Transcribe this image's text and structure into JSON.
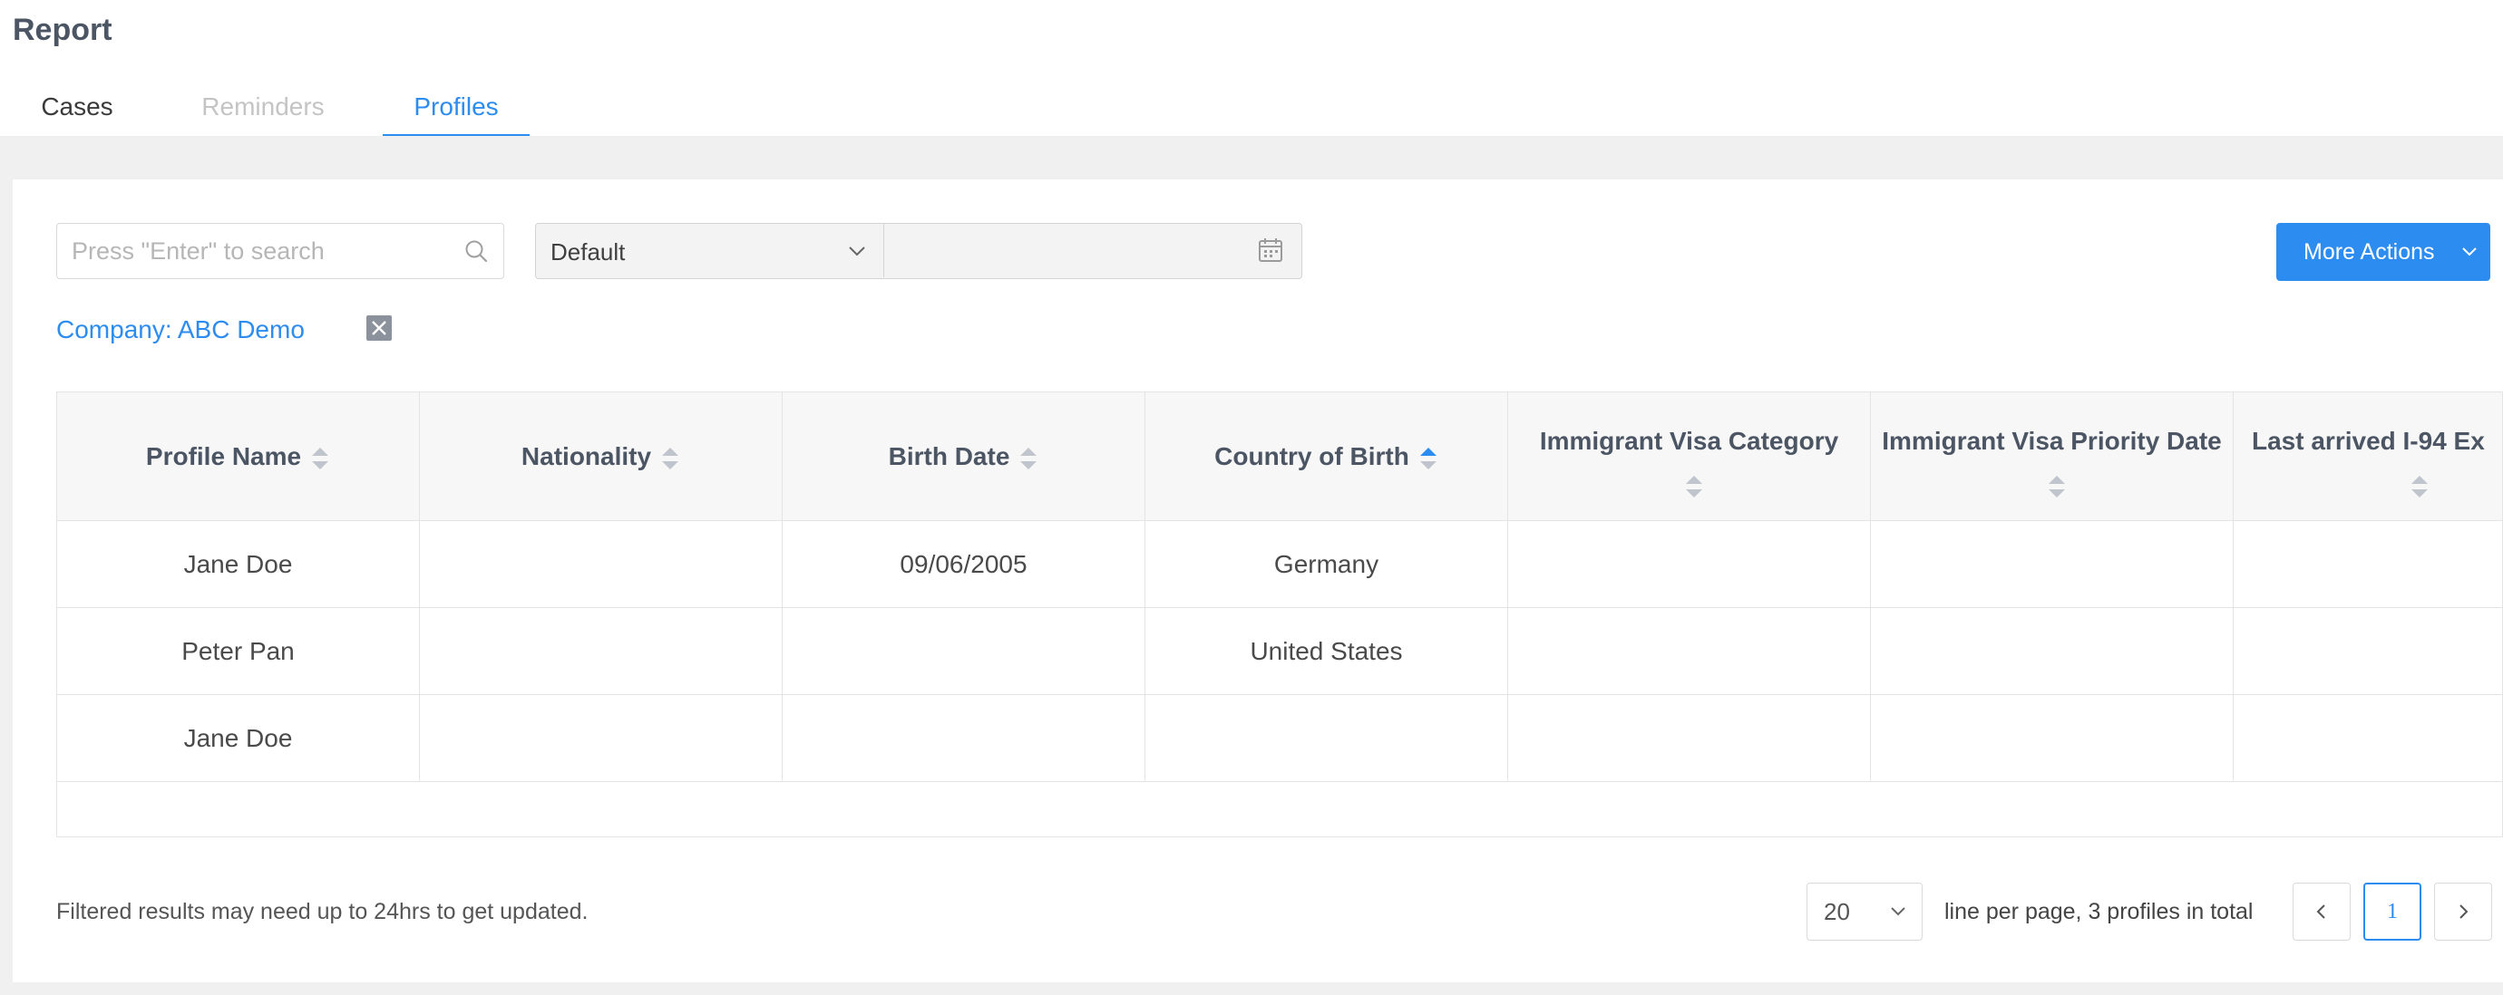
{
  "page": {
    "title": "Report"
  },
  "tabs": {
    "cases": "Cases",
    "reminders": "Reminders",
    "profiles": "Profiles",
    "active": "Profiles"
  },
  "toolbar": {
    "search": {
      "placeholder": "Press \"Enter\" to search",
      "value": ""
    },
    "date_range_type": "Default",
    "date_picker_value": "",
    "more_actions": "More Actions"
  },
  "filters": [
    {
      "label": "Company: ABC Demo"
    }
  ],
  "table": {
    "columns": [
      {
        "label": "Profile Name",
        "sort": "none"
      },
      {
        "label": "Nationality",
        "sort": "none"
      },
      {
        "label": "Birth Date",
        "sort": "none"
      },
      {
        "label": "Country of Birth",
        "sort": "asc"
      },
      {
        "label": "Immigrant Visa Category",
        "sort": "none"
      },
      {
        "label": "Immigrant Visa Priority Date",
        "sort": "none"
      },
      {
        "label": "Last arrived I-94 Ex",
        "sort": "none"
      }
    ],
    "rows": [
      [
        "Jane Doe",
        "",
        "09/06/2005",
        "Germany",
        "",
        "",
        ""
      ],
      [
        "Peter Pan",
        "",
        "",
        "United States",
        "",
        "",
        ""
      ],
      [
        "Jane Doe",
        "",
        "",
        "",
        "",
        "",
        ""
      ]
    ]
  },
  "footer": {
    "note": "Filtered results may need up to 24hrs to get updated.",
    "page_size": "20",
    "summary": "line per page, 3 profiles in total",
    "current_page": "1"
  },
  "colors": {
    "accent": "#2d8cf0",
    "sort_inactive": "#c0c4cc"
  },
  "icons": {
    "search": "search-icon",
    "calendar": "calendar-icon",
    "chevron": "chevron-down-icon",
    "remove": "close-icon",
    "prev": "chevron-left-icon",
    "next": "chevron-right-icon"
  }
}
